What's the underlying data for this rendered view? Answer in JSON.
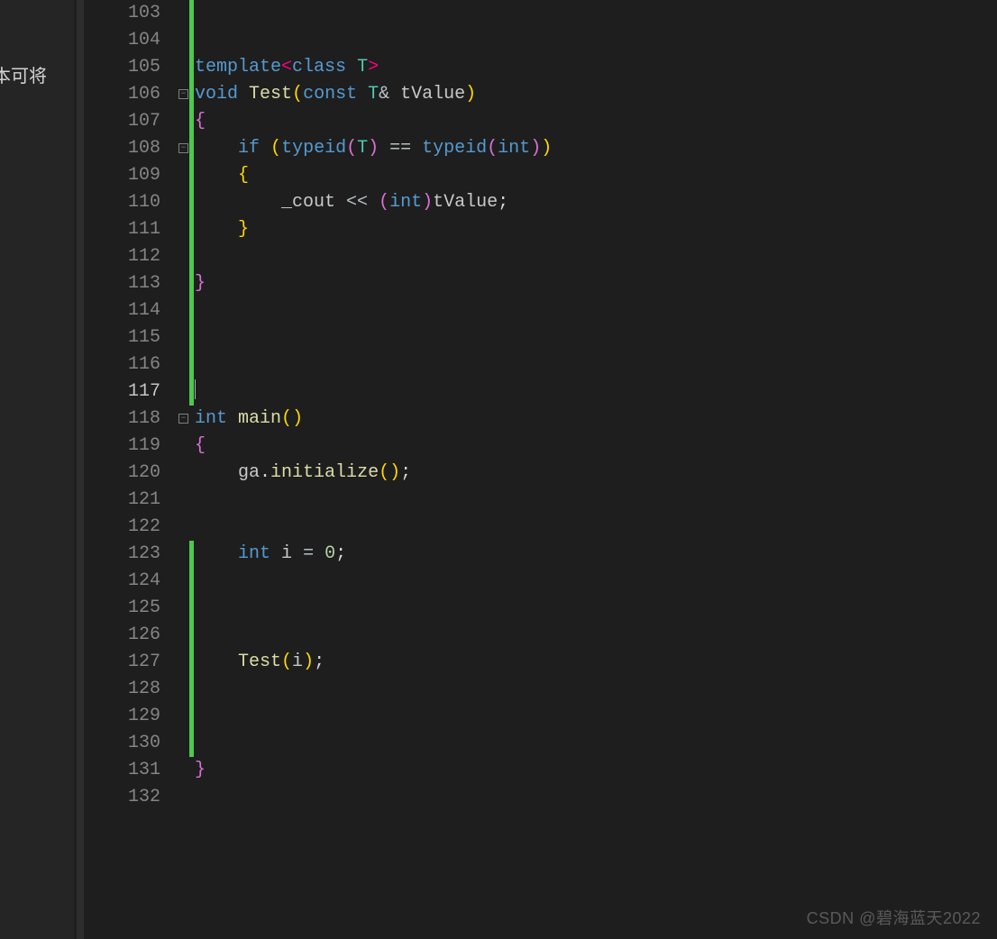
{
  "left_panel": {
    "partial_text": "本可将"
  },
  "watermark": "CSDN @碧海蓝天2022",
  "gutter": {
    "start": 103,
    "end": 132,
    "current": 117
  },
  "fold_markers": [
    106,
    108,
    118
  ],
  "change_bars": [
    [
      103,
      117
    ],
    [
      123,
      130
    ]
  ],
  "code": {
    "103": [],
    "104": [],
    "105": [
      {
        "t": "template",
        "c": "tok-kw"
      },
      {
        "t": "<",
        "c": "tok-angle"
      },
      {
        "t": "class",
        "c": "tok-kw"
      },
      {
        "t": " ",
        "c": ""
      },
      {
        "t": "T",
        "c": "tok-type"
      },
      {
        "t": ">",
        "c": "tok-angle"
      }
    ],
    "106": [
      {
        "t": "void",
        "c": "tok-kw"
      },
      {
        "t": " ",
        "c": ""
      },
      {
        "t": "Test",
        "c": "tok-fn"
      },
      {
        "t": "(",
        "c": "tok-paren"
      },
      {
        "t": "const",
        "c": "tok-kw"
      },
      {
        "t": " ",
        "c": ""
      },
      {
        "t": "T",
        "c": "tok-type"
      },
      {
        "t": "&",
        "c": "tok-op"
      },
      {
        "t": " ",
        "c": ""
      },
      {
        "t": "tValue",
        "c": "tok-id"
      },
      {
        "t": ")",
        "c": "tok-paren"
      }
    ],
    "107": [
      {
        "t": "{",
        "c": "tok-brace"
      }
    ],
    "108": [
      {
        "t": "    ",
        "c": ""
      },
      {
        "t": "if",
        "c": "tok-kw"
      },
      {
        "t": " ",
        "c": ""
      },
      {
        "t": "(",
        "c": "tok-paren"
      },
      {
        "t": "typeid",
        "c": "tok-kw"
      },
      {
        "t": "(",
        "c": "tok-brace"
      },
      {
        "t": "T",
        "c": "tok-type"
      },
      {
        "t": ")",
        "c": "tok-brace"
      },
      {
        "t": " == ",
        "c": "tok-op"
      },
      {
        "t": "typeid",
        "c": "tok-kw"
      },
      {
        "t": "(",
        "c": "tok-brace"
      },
      {
        "t": "int",
        "c": "tok-kw"
      },
      {
        "t": ")",
        "c": "tok-brace"
      },
      {
        "t": ")",
        "c": "tok-paren"
      }
    ],
    "109": [
      {
        "t": "    ",
        "c": ""
      },
      {
        "t": "{",
        "c": "tok-paren"
      }
    ],
    "110": [
      {
        "t": "        ",
        "c": ""
      },
      {
        "t": "_cout",
        "c": "tok-id"
      },
      {
        "t": " << ",
        "c": "tok-op"
      },
      {
        "t": "(",
        "c": "tok-brace"
      },
      {
        "t": "int",
        "c": "tok-cast"
      },
      {
        "t": ")",
        "c": "tok-brace"
      },
      {
        "t": "tValue",
        "c": "tok-id"
      },
      {
        "t": ";",
        "c": "tok-punc"
      }
    ],
    "111": [
      {
        "t": "    ",
        "c": ""
      },
      {
        "t": "}",
        "c": "tok-paren"
      }
    ],
    "112": [],
    "113": [
      {
        "t": "}",
        "c": "tok-brace"
      }
    ],
    "114": [],
    "115": [],
    "116": [],
    "117": [
      {
        "t": "",
        "c": "",
        "cursor": true
      }
    ],
    "118": [
      {
        "t": "int",
        "c": "tok-kw"
      },
      {
        "t": " ",
        "c": ""
      },
      {
        "t": "main",
        "c": "tok-fn"
      },
      {
        "t": "(",
        "c": "tok-paren"
      },
      {
        "t": ")",
        "c": "tok-paren"
      }
    ],
    "119": [
      {
        "t": "{",
        "c": "tok-brace"
      }
    ],
    "120": [
      {
        "t": "    ",
        "c": ""
      },
      {
        "t": "ga",
        "c": "tok-id"
      },
      {
        "t": ".",
        "c": "tok-punc"
      },
      {
        "t": "initialize",
        "c": "tok-fn"
      },
      {
        "t": "(",
        "c": "tok-paren"
      },
      {
        "t": ")",
        "c": "tok-paren"
      },
      {
        "t": ";",
        "c": "tok-punc"
      }
    ],
    "121": [],
    "122": [],
    "123": [
      {
        "t": "    ",
        "c": ""
      },
      {
        "t": "int",
        "c": "tok-kw"
      },
      {
        "t": " ",
        "c": ""
      },
      {
        "t": "i",
        "c": "tok-id"
      },
      {
        "t": " = ",
        "c": "tok-op"
      },
      {
        "t": "0",
        "c": "tok-num"
      },
      {
        "t": ";",
        "c": "tok-punc"
      }
    ],
    "124": [],
    "125": [],
    "126": [],
    "127": [
      {
        "t": "    ",
        "c": ""
      },
      {
        "t": "Test",
        "c": "tok-fn"
      },
      {
        "t": "(",
        "c": "tok-paren"
      },
      {
        "t": "i",
        "c": "tok-id"
      },
      {
        "t": ")",
        "c": "tok-paren"
      },
      {
        "t": ";",
        "c": "tok-punc"
      }
    ],
    "128": [],
    "129": [],
    "130": [],
    "131": [
      {
        "t": "}",
        "c": "tok-brace"
      }
    ],
    "132": []
  },
  "indent_guides_inside_fn1": [
    107,
    108,
    109,
    110,
    111,
    112,
    113
  ],
  "indent_guides_inside_fn2": [
    119,
    120,
    121,
    122,
    123,
    124,
    125,
    126,
    127,
    128,
    129,
    130,
    131
  ]
}
